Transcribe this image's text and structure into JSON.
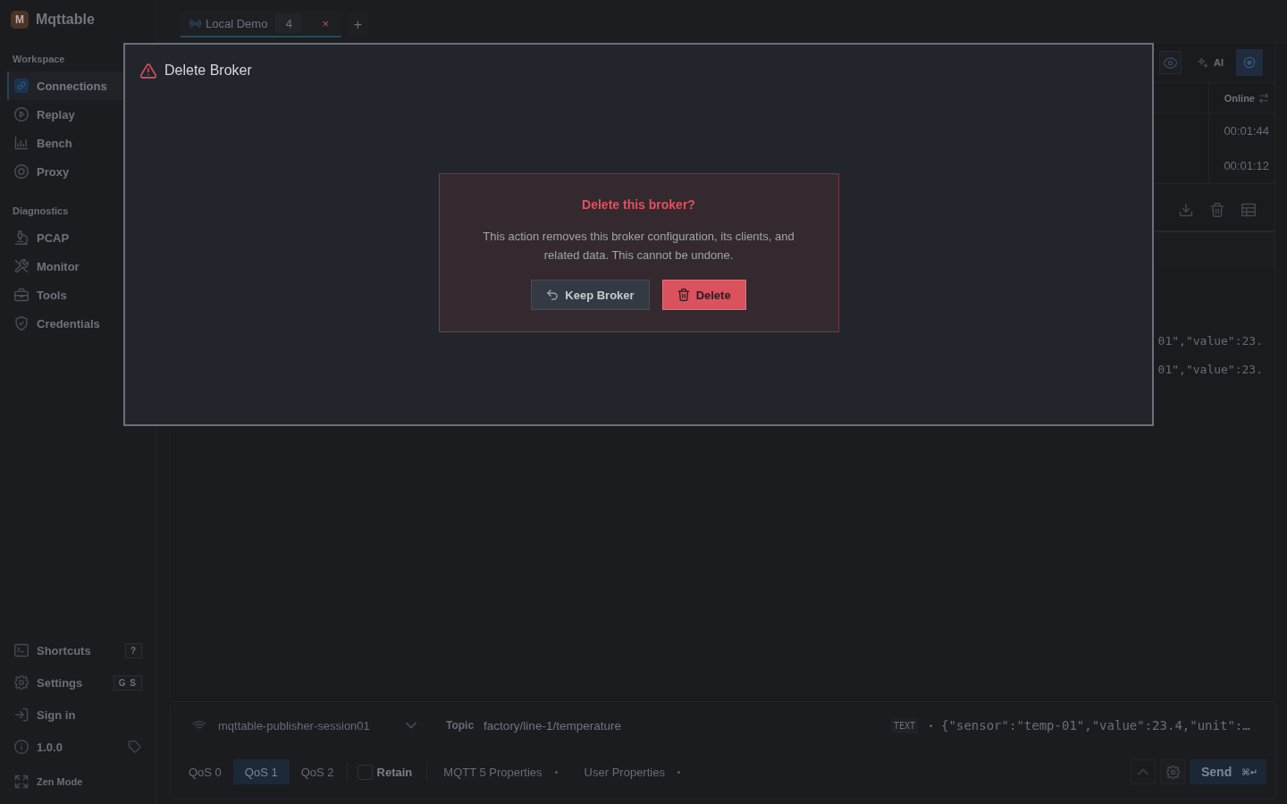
{
  "sidebar": {
    "logo_letter": "M",
    "app_name": "Mqttable",
    "sections": [
      {
        "title": "Workspace",
        "items": [
          {
            "label": "Connections",
            "selected": true
          },
          {
            "label": "Replay",
            "selected": false
          },
          {
            "label": "Bench",
            "selected": false
          },
          {
            "label": "Proxy",
            "selected": false
          }
        ]
      },
      {
        "title": "Diagnostics",
        "items": [
          {
            "label": "PCAP",
            "selected": false
          },
          {
            "label": "Monitor",
            "selected": false
          },
          {
            "label": "Tools",
            "selected": false
          },
          {
            "label": "Credentials",
            "selected": false
          }
        ]
      }
    ],
    "footer": [
      {
        "label": "Shortcuts",
        "shortcut": "?"
      },
      {
        "label": "Settings",
        "shortcut": "G S"
      },
      {
        "label": "Sign in"
      }
    ],
    "version": "1.0.0",
    "zen_mode": "Zen Mode"
  },
  "tabs": [
    {
      "label": "Local Demo",
      "count": "4",
      "close": "×",
      "selected": true
    }
  ],
  "new_tab": "+",
  "toolbar": {
    "ai_label": "AI"
  },
  "clients_table": {
    "columns": [
      "Online"
    ],
    "rows": [
      [
        "00:01:44"
      ],
      [
        "00:01:12"
      ]
    ]
  },
  "messages": [
    {
      "payload": "01\",\"value\":23."
    },
    {
      "payload": "01\",\"value\":23."
    }
  ],
  "publisher": {
    "client": "mqttable-publisher-session01",
    "topic_label": "Topic",
    "topic": "factory/line-1/temperature",
    "format": "TEXT",
    "payload": "{\"sensor\":\"temp-01\",\"value\":23.4,\"unit\":…",
    "qos": [
      {
        "label": "QoS 0",
        "selected": false
      },
      {
        "label": "QoS 1",
        "selected": true
      },
      {
        "label": "QoS 2",
        "selected": false
      }
    ],
    "retain": {
      "label": "Retain",
      "checked": false
    },
    "properties": [
      "MQTT 5 Properties",
      "User Properties"
    ],
    "send": {
      "label": "Send",
      "shortcut": "⌘↵"
    }
  },
  "dialog": {
    "title": "Delete Broker",
    "heading": "Delete this broker?",
    "message": "This action removes this broker configuration, its clients, and related data. This cannot be undone.",
    "buttons": [
      {
        "label": "Keep Broker",
        "kind": "secondary"
      },
      {
        "label": "Delete",
        "kind": "danger"
      }
    ]
  }
}
